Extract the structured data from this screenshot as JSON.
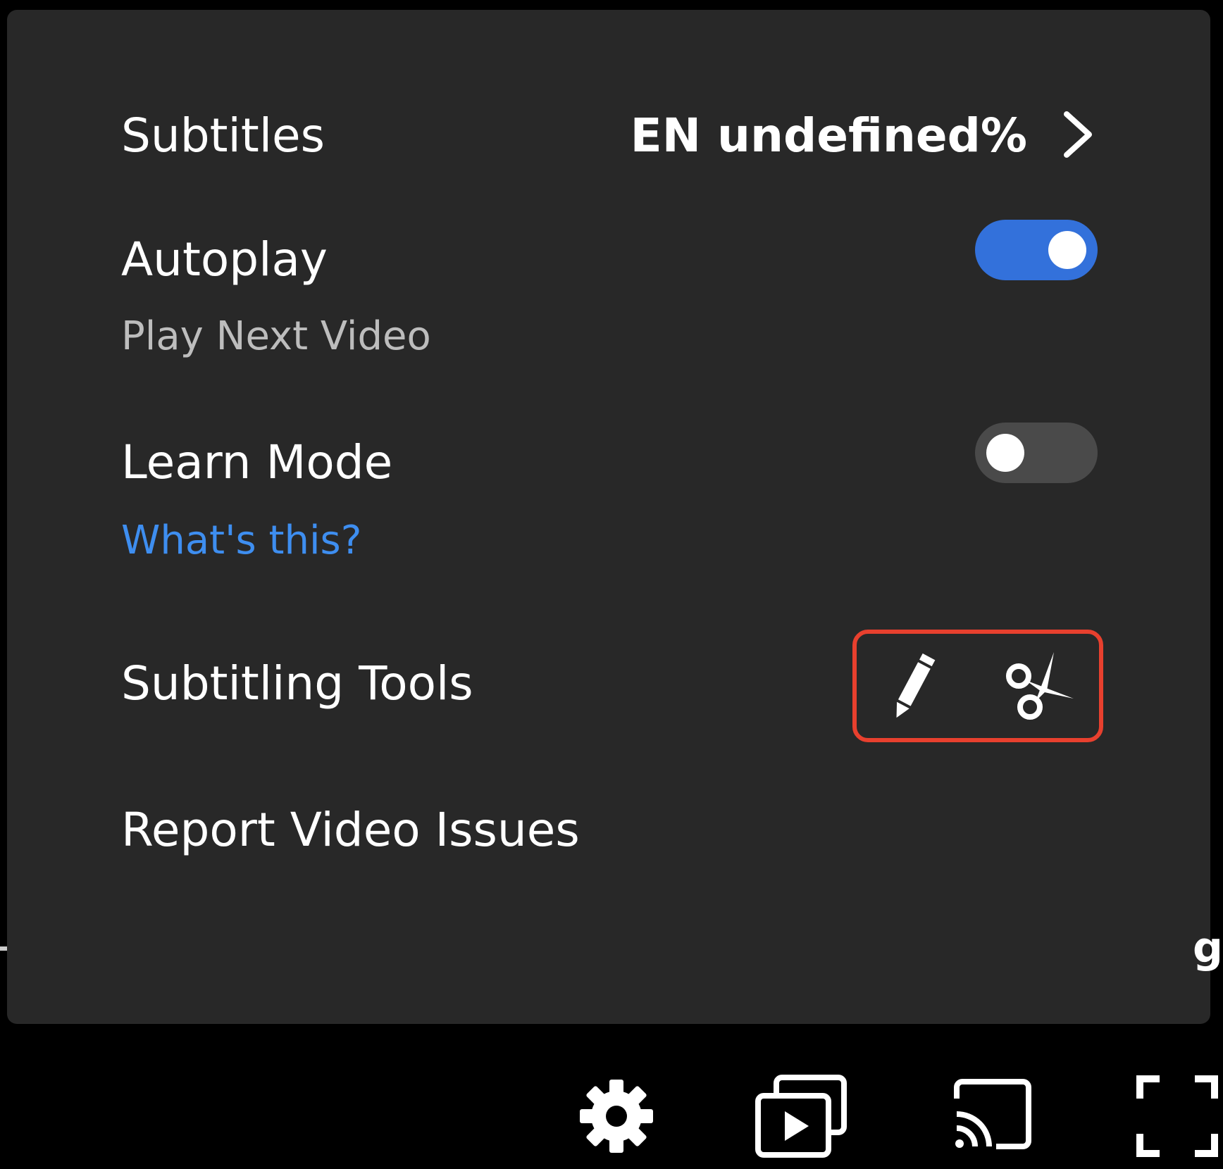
{
  "settings_menu": {
    "subtitles": {
      "label": "Subtitles",
      "value": "EN undefined%",
      "icon": "chevron-right-icon"
    },
    "autoplay": {
      "label": "Autoplay",
      "description": "Play Next Video",
      "enabled": true
    },
    "learn_mode": {
      "label": "Learn Mode",
      "help_link": "What's this?",
      "enabled": false
    },
    "subtitling_tools": {
      "label": "Subtitling Tools",
      "tools": [
        "pencil-icon",
        "scissors-icon"
      ]
    },
    "report": {
      "label": "Report Video Issues"
    }
  },
  "controls": {
    "icons": [
      "gear-icon",
      "playlist-icon",
      "cast-icon",
      "fullscreen-icon"
    ]
  },
  "edge_text": {
    "right_glyph": "g"
  },
  "colors": {
    "panel_bg": "#282828",
    "toggle_on": "#3371db",
    "toggle_off": "#4a4a4a",
    "link": "#3e8ef0",
    "highlight": "#e8402e"
  }
}
